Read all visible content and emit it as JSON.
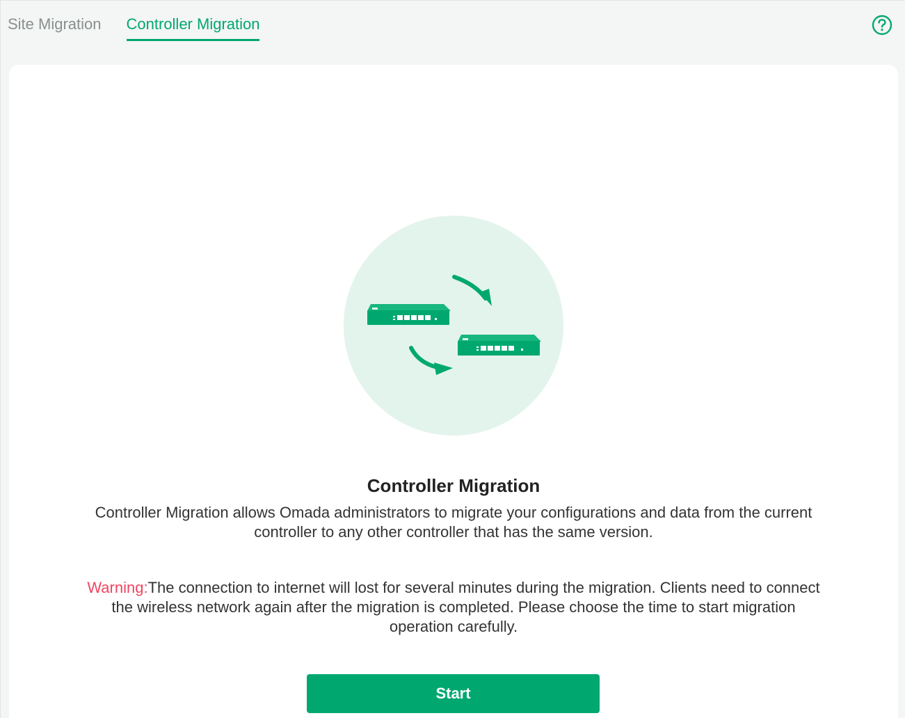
{
  "tabs": [
    {
      "label": "Site Migration",
      "active": false
    },
    {
      "label": "Controller Migration",
      "active": true
    }
  ],
  "help": {
    "icon": "help-circle-icon"
  },
  "content": {
    "title": "Controller Migration",
    "description": "Controller Migration allows Omada administrators to migrate your configurations and data from the current controller to any other controller that has the same version.",
    "warning_label": "Warning:",
    "warning_text": "The connection to internet will lost for several minutes during the migration. Clients need to connect the wireless network again after the migration is completed. Please choose the time to start migration operation carefully.",
    "start_label": "Start"
  },
  "colors": {
    "accent": "#00a870",
    "warning": "#ef4560",
    "illustration_bg": "#e3f4ec"
  }
}
